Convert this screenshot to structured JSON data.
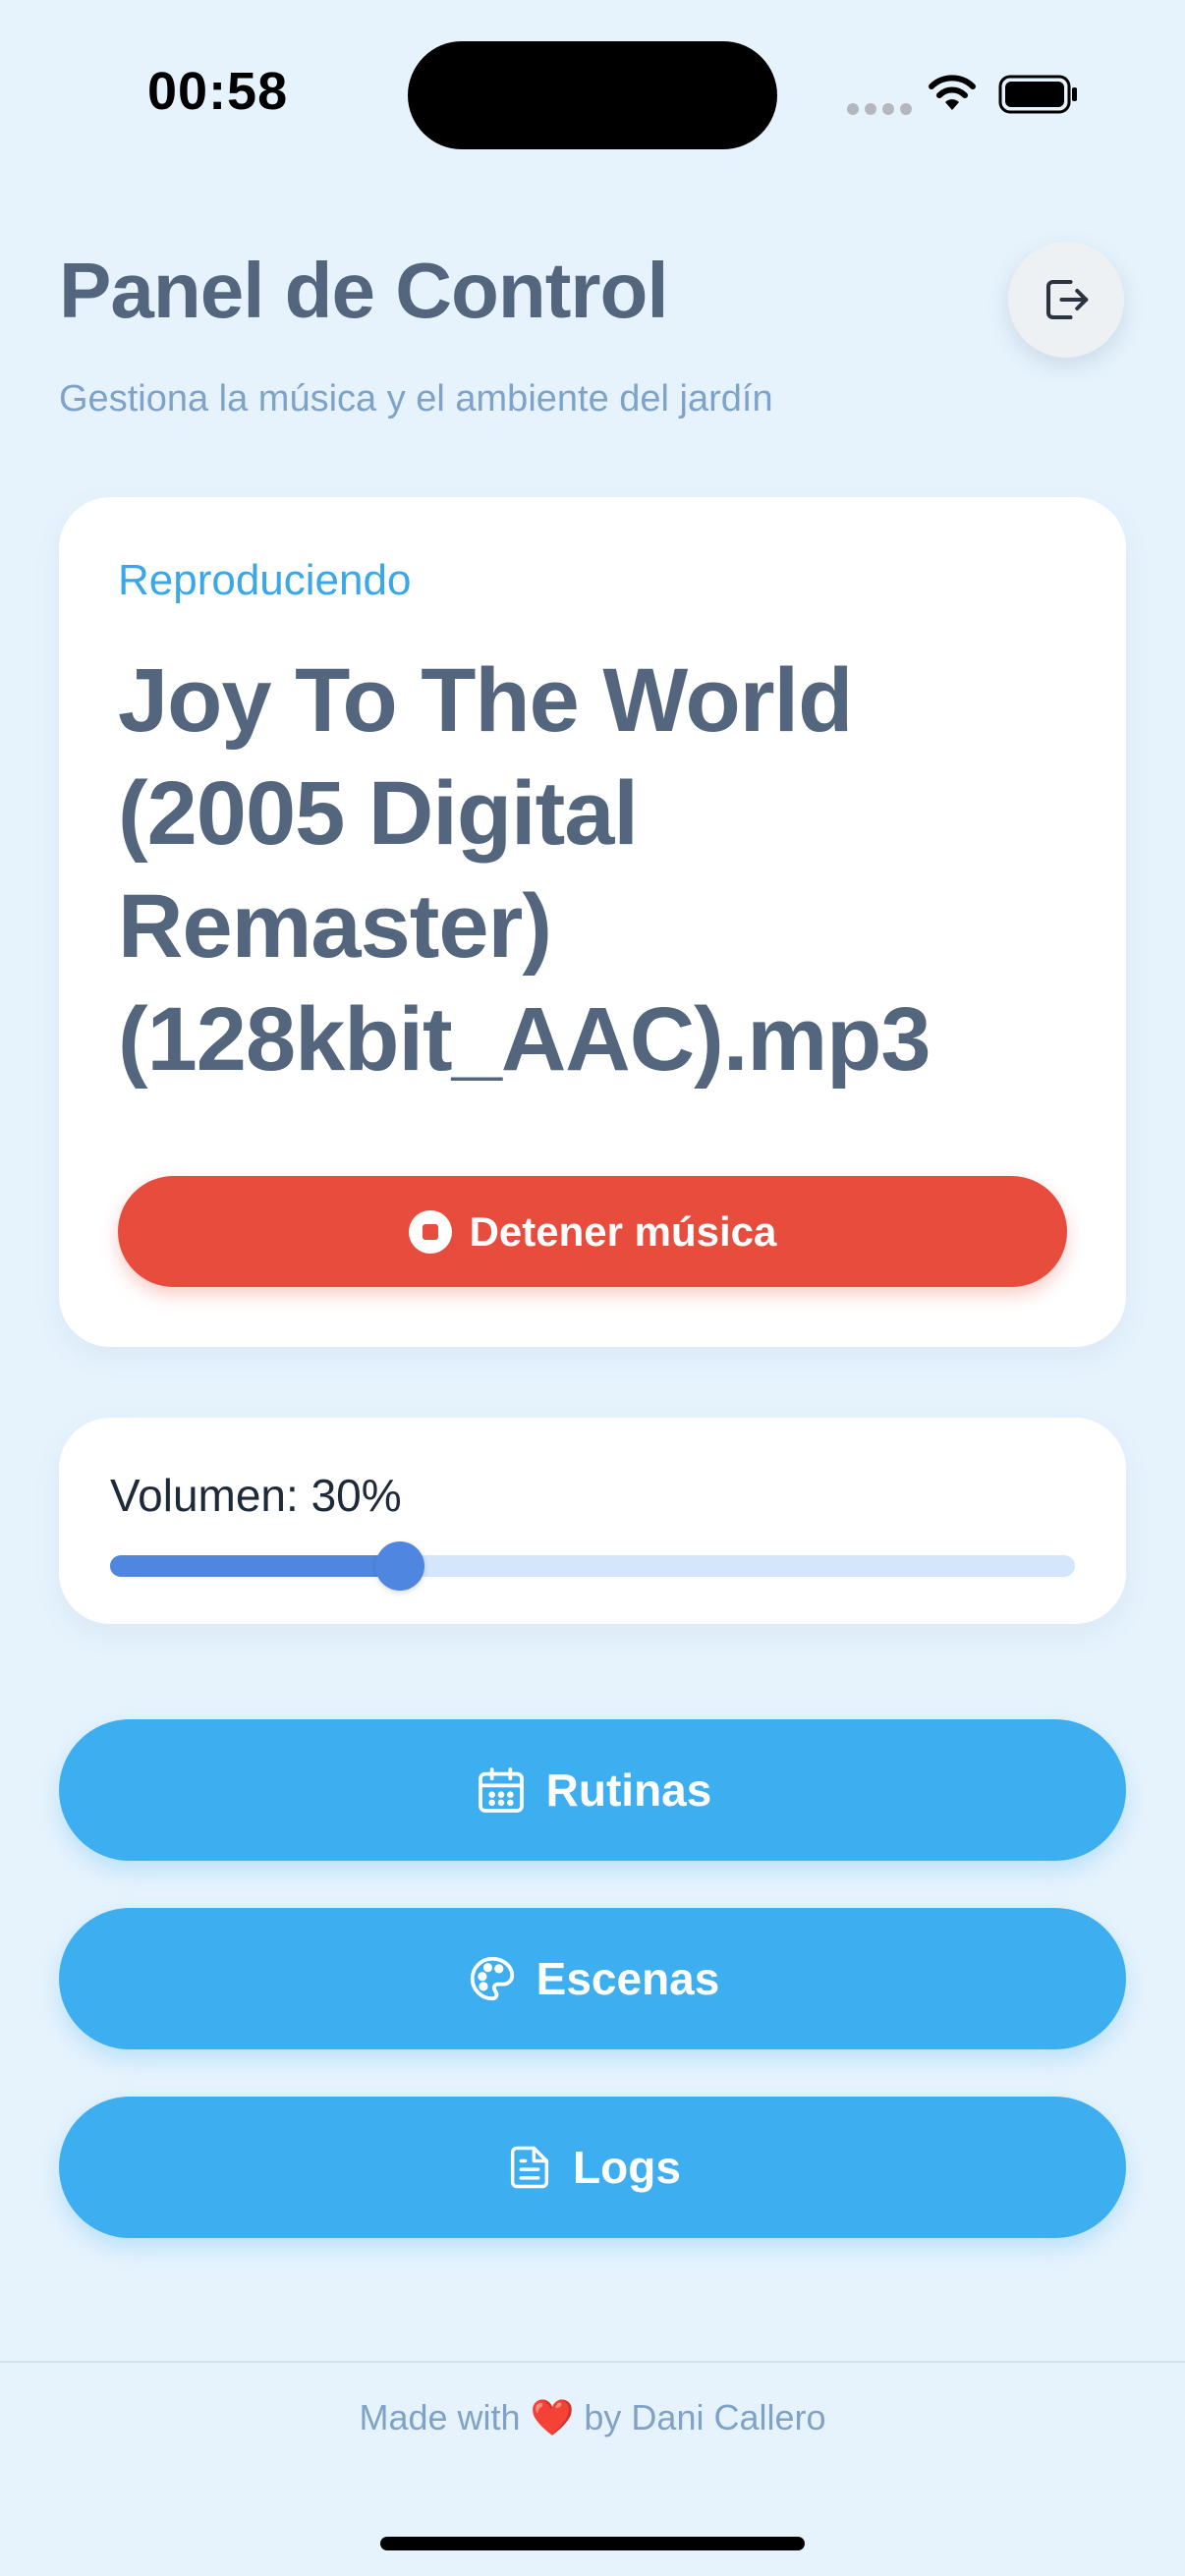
{
  "status_bar": {
    "time": "00:58",
    "icons": [
      "cellular-dots-icon",
      "wifi-icon",
      "battery-icon"
    ]
  },
  "header": {
    "title": "Panel de Control",
    "subtitle": "Gestiona la música y el ambiente del jardín",
    "logout_icon": "logout-icon"
  },
  "now_playing": {
    "label": "Reproduciendo",
    "track": "Joy To The World (2005 Digital Remaster) (128kbit_AAC).mp3",
    "stop_button": {
      "label": "Detener música",
      "icon": "stop-icon"
    }
  },
  "volume": {
    "label": "Volumen: 30%",
    "value": 0.3
  },
  "nav": {
    "rutinas": {
      "label": "Rutinas",
      "icon": "calendar-icon"
    },
    "escenas": {
      "label": "Escenas",
      "icon": "palette-icon"
    },
    "logs": {
      "label": "Logs",
      "icon": "document-icon"
    }
  },
  "footer": {
    "prefix": "Made with",
    "heart": "❤️",
    "suffix": "by Dani Callero"
  },
  "colors": {
    "background": "#e6f3fd",
    "accent": "#3daef0",
    "danger": "#e74c3c",
    "slider": "#4f87e0",
    "title": "#53667d"
  }
}
